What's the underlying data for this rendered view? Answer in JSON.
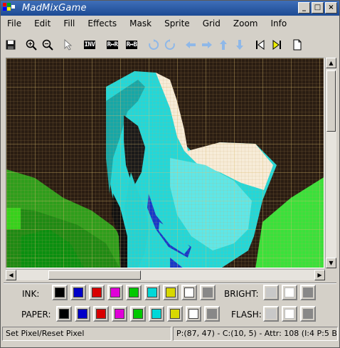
{
  "window": {
    "title": "MadMixGame"
  },
  "menu": [
    "File",
    "Edit",
    "Fill",
    "Effects",
    "Mask",
    "Sprite",
    "Grid",
    "Zoom",
    "Info"
  ],
  "toolbar": {
    "inv_label": "INV",
    "rr_label": "R↔R",
    "rb_label": "R↔B"
  },
  "palette": {
    "ink_label": "INK:",
    "paper_label": "PAPER:",
    "bright_label": "BRIGHT:",
    "flash_label": "FLASH:",
    "colors": [
      "#000000",
      "#0000c8",
      "#d80000",
      "#e000d8",
      "#00c800",
      "#00d8d8",
      "#d8d800",
      "#ffffff"
    ]
  },
  "status": {
    "left": "Set Pixel/Reset Pixel",
    "right": "P:(87, 47) - C:(10, 5) - Attr: 108 (I:4 P:5 B"
  }
}
